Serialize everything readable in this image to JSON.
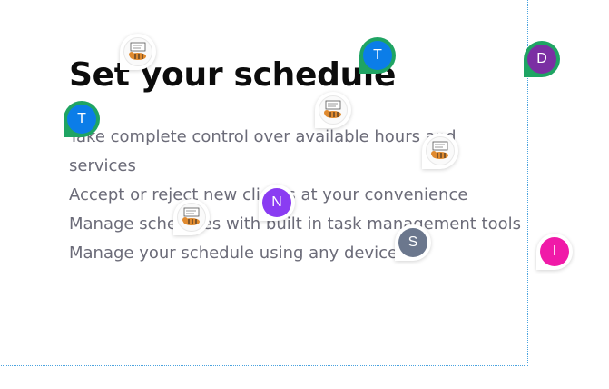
{
  "section": {
    "title": "Set your schedule",
    "features": [
      "Take complete control over available hours and services",
      "Accept or reject new clients at your convenience",
      "Manage schedules with built in task management tools",
      "Manage your schedule using any device"
    ]
  },
  "presence": [
    {
      "initial": "T",
      "color": "#0b7de8"
    },
    {
      "initial": "D",
      "color": "#7b2fa3"
    },
    {
      "initial": "T",
      "color": "#0b7de8"
    },
    {
      "initial": "N",
      "color": "#8a3cf2"
    },
    {
      "initial": "S",
      "color": "#6b778d"
    },
    {
      "initial": "I",
      "color": "#f01aa8"
    }
  ],
  "avatar_icon": "tiger-avatar-icon"
}
